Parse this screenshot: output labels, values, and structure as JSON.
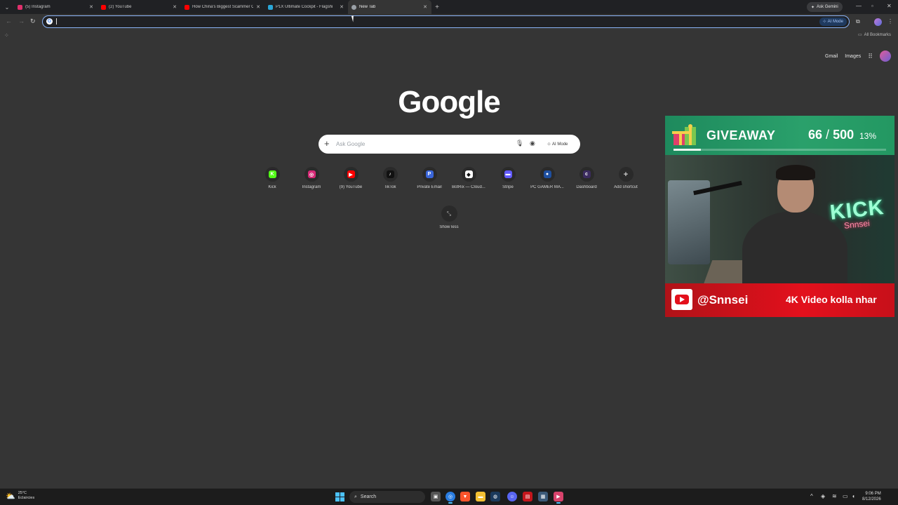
{
  "browser": {
    "tabs": [
      {
        "title": "(5) Instagram",
        "favicon_color": "#e1306c",
        "active": false
      },
      {
        "title": "(2) YouTube",
        "favicon_color": "#ff0000",
        "active": false
      },
      {
        "title": "How China's Biggest Scammer C",
        "favicon_color": "#ff0000",
        "active": false
      },
      {
        "title": "P1X Ultimate Cockpit - Flagshi",
        "favicon_color": "#2aa7d8",
        "active": false
      },
      {
        "title": "New Tab",
        "favicon_color": "#9aa0a6",
        "active": true
      }
    ],
    "ask_gemini_label": "Ask Gemini",
    "omnibox": {
      "value": "",
      "ai_mode_label": "AI Mode"
    },
    "all_bookmarks_label": "All Bookmarks"
  },
  "ntp": {
    "top_links": {
      "gmail": "Gmail",
      "images": "Images"
    },
    "logo": "Google",
    "search_placeholder": "Ask Google",
    "ai_mode_label": "AI Mode",
    "shortcuts": [
      {
        "label": "Kick",
        "icon": "kick-icon",
        "color": "#53fc18",
        "glyph": "K"
      },
      {
        "label": "Instagram",
        "icon": "instagram-icon",
        "color": "#d62976",
        "glyph": "◎"
      },
      {
        "label": "(9) YouTube",
        "icon": "youtube-icon",
        "color": "#ff0000",
        "glyph": "▶"
      },
      {
        "label": "TikTok",
        "icon": "tiktok-icon",
        "color": "#111111",
        "glyph": "♪"
      },
      {
        "label": "Private Email",
        "icon": "private-email-icon",
        "color": "#3a66d9",
        "glyph": "P"
      },
      {
        "label": "BotRix — Cloud...",
        "icon": "botrix-icon",
        "color": "#ffffff",
        "glyph": "◆"
      },
      {
        "label": "Stripe",
        "icon": "stripe-icon",
        "color": "#635bff",
        "glyph": "▬"
      },
      {
        "label": "PC GAMER MA...",
        "icon": "pc-gamer-icon",
        "color": "#1e4fa0",
        "glyph": "●"
      },
      {
        "label": "Dashboard",
        "icon": "dashboard-icon",
        "color": "#3b2b5e",
        "glyph": "c"
      },
      {
        "label": "Add shortcut",
        "icon": "plus-icon",
        "color": "#2a2a2a",
        "glyph": "+"
      }
    ],
    "show_less_label": "Show less"
  },
  "overlay": {
    "giveaway_title": "GIVEAWAY",
    "count": "66",
    "separator": "/",
    "goal": "500",
    "percent": "13%",
    "progress_fraction": 0.13,
    "neon_sign": "KICK",
    "neon_sub": "Snnsei",
    "youtube_handle": "@Snnsei",
    "promo_text": "4K Video kolla nhar"
  },
  "taskbar": {
    "temperature": "25°C",
    "weather_desc": "Eclaircies",
    "search_label": "Search",
    "time": "9:06 PM",
    "date": "8/12/2026"
  },
  "colors": {
    "page_bg": "#353535",
    "accent_blue": "#8ab4f8",
    "giveaway_green": "#2aa06b",
    "youtube_red": "#e3101c"
  }
}
